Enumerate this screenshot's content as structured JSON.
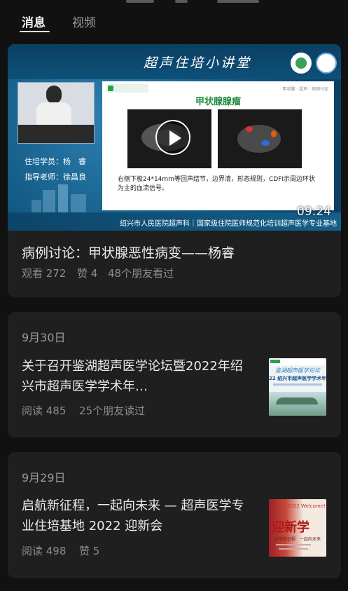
{
  "tabs": [
    {
      "label": "消息",
      "active": true
    },
    {
      "label": "视频",
      "active": false
    }
  ],
  "video_card": {
    "thumbnail": {
      "banner_title": "超声住培小讲堂",
      "student_line": "住培学员：杨　睿",
      "teacher_line": "指导老师：徐昌良",
      "slide_heading": "甲状腺腺瘤",
      "slide_caption": "右侧下极24*14mm等回声结节，边界清，形态规则，CDFI示周边环状为主的血流信号。",
      "footer_text": "绍兴市人民医院超声科｜国家级住院医师规范化培训超声医学专业基地",
      "duration": "09:24"
    },
    "title": "病例讨论：甲状腺恶性病变——杨睿",
    "views": "观看 272",
    "likes": "赞 4",
    "friends": "48个朋友看过"
  },
  "articles": [
    {
      "date": "9月30日",
      "title": "关于召开鉴湖超声医学论坛暨2022年绍兴市超声医学学术年…",
      "reads": "阅读 485",
      "friends": "25个朋友读过",
      "thumbnail_text_top": "鉴湖超声医学论坛",
      "thumbnail_text_mid": "22 绍兴市超声医学学术年"
    },
    {
      "date": "9月29日",
      "title": "启航新征程，一起向未来 — 超声医学专业住培基地 2022 迎新会",
      "reads": "阅读 498",
      "likes": "赞 5",
      "thumbnail_text_badge": "2022 Welcome!",
      "thumbnail_text_main": "迎新学",
      "thumbnail_text_sub": "启航新征程　一起向未来"
    }
  ],
  "colors": {
    "background": "#111111",
    "card": "#1f1f1f",
    "primary_text": "#ebebeb",
    "secondary_text": "#8c8c8c",
    "slide_heading": "#1e8a3e"
  }
}
